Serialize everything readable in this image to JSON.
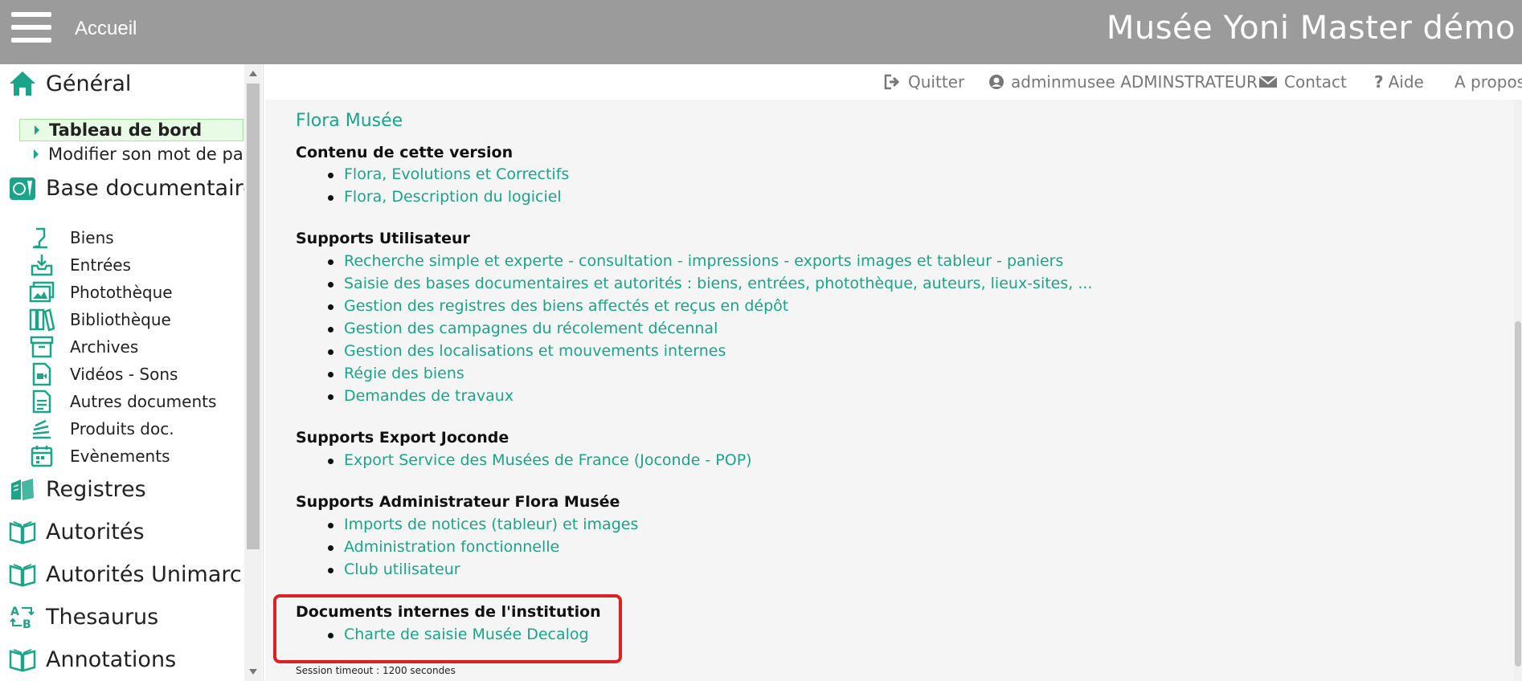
{
  "header": {
    "menu_icon": "hamburger-menu-icon",
    "home_label": "Accueil",
    "app_title": "Musée Yoni Master démo",
    "bg_color": "#9b9b9b"
  },
  "sidebar": {
    "general": {
      "label": "Général",
      "icon": "home-icon",
      "items": [
        {
          "label": "Tableau de bord",
          "active": true
        },
        {
          "label": "Modifier son mot de pas..."
        }
      ]
    },
    "base_documentaire": {
      "label": "Base documentaire",
      "icon": "database-icon",
      "items": [
        {
          "label": "Biens",
          "icon": "object-icon"
        },
        {
          "label": "Entrées",
          "icon": "inbox-icon"
        },
        {
          "label": "Photothèque",
          "icon": "images-icon"
        },
        {
          "label": "Bibliothèque",
          "icon": "books-icon"
        },
        {
          "label": "Archives",
          "icon": "archive-box-icon"
        },
        {
          "label": "Vidéos - Sons",
          "icon": "video-file-icon"
        },
        {
          "label": "Autres documents",
          "icon": "document-icon"
        },
        {
          "label": "Produits doc.",
          "icon": "stack-icon"
        },
        {
          "label": "Evènements",
          "icon": "calendar-icon"
        }
      ]
    },
    "sections": [
      {
        "label": "Registres",
        "icon": "registers-icon"
      },
      {
        "label": "Autorités",
        "icon": "open-book-icon"
      },
      {
        "label": "Autorités Unimarc",
        "icon": "open-book-icon"
      },
      {
        "label": "Thesaurus",
        "icon": "thesaurus-icon"
      },
      {
        "label": "Annotations",
        "icon": "open-book-icon"
      }
    ]
  },
  "utilbar": {
    "quit": "Quitter",
    "user": "adminmusee ADMINSTRATEUR",
    "contact": "Contact",
    "help": "Aide",
    "about": "A propos"
  },
  "content": {
    "brand": "Flora Musée",
    "sections": [
      {
        "title": "Contenu de cette version",
        "links": [
          "Flora, Evolutions et Correctifs",
          "Flora, Description du logiciel"
        ]
      },
      {
        "title": "Supports Utilisateur",
        "links": [
          "Recherche simple et experte - consultation - impressions - exports images et tableur - paniers",
          "Saisie des bases documentaires et autorités : biens, entrées, photothèque, auteurs, lieux-sites, ...",
          "Gestion des registres des biens affectés et reçus en dépôt",
          "Gestion des campagnes du récolement décennal",
          "Gestion des localisations et mouvements internes",
          "Régie des biens",
          "Demandes de travaux"
        ]
      },
      {
        "title": "Supports Export Joconde",
        "links": [
          "Export Service des Musées de France (Joconde - POP)"
        ]
      },
      {
        "title": "Supports Administrateur Flora Musée",
        "links": [
          "Imports de notices (tableur) et images",
          "Administration fonctionnelle",
          "Club utilisateur"
        ]
      },
      {
        "title": "Documents internes de l'institution",
        "links": [
          "Charte de saisie Musée Decalog"
        ]
      }
    ],
    "footer": "Session timeout : 1200 secondes",
    "accent_color": "#1aa58b",
    "highlight_color": "#e02020"
  }
}
